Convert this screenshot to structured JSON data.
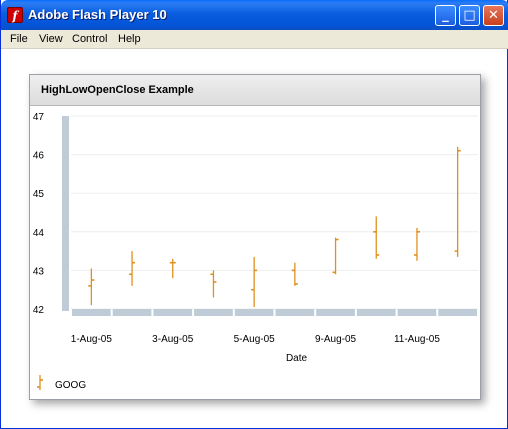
{
  "window": {
    "title": "Adobe Flash Player 10"
  },
  "menu": {
    "items": [
      "File",
      "View",
      "Control",
      "Help"
    ]
  },
  "panel": {
    "title": "HighLowOpenClose Example"
  },
  "colors": {
    "series": "#E0901E",
    "axis_bar": "#BFCBD7",
    "titlebar": "#0A5EE0"
  },
  "chart_data": {
    "type": "hloc",
    "title": "HighLowOpenClose Example",
    "xlabel": "Date",
    "ylabel": "",
    "ylim": [
      42,
      47
    ],
    "yticks": [
      42,
      43,
      44,
      45,
      46,
      47
    ],
    "xtick_labels": [
      "1-Aug-05",
      "3-Aug-05",
      "5-Aug-05",
      "9-Aug-05",
      "11-Aug-05"
    ],
    "legend": {
      "position": "bottom-left",
      "entries": [
        "GOOG"
      ]
    },
    "series": [
      {
        "name": "GOOG",
        "points": [
          {
            "date": "1-Aug-05",
            "open": 42.6,
            "high": 43.05,
            "low": 42.1,
            "close": 42.75
          },
          {
            "date": "2-Aug-05",
            "open": 42.9,
            "high": 43.5,
            "low": 42.6,
            "close": 43.2
          },
          {
            "date": "3-Aug-05",
            "open": 43.2,
            "high": 43.3,
            "low": 42.8,
            "close": 43.2
          },
          {
            "date": "4-Aug-05",
            "open": 42.9,
            "high": 43.0,
            "low": 42.3,
            "close": 42.7
          },
          {
            "date": "5-Aug-05",
            "open": 42.5,
            "high": 43.35,
            "low": 42.05,
            "close": 43.0
          },
          {
            "date": "8-Aug-05",
            "open": 43.0,
            "high": 43.2,
            "low": 42.6,
            "close": 42.65
          },
          {
            "date": "9-Aug-05",
            "open": 42.95,
            "high": 43.85,
            "low": 42.9,
            "close": 43.8
          },
          {
            "date": "10-Aug-05",
            "open": 44.0,
            "high": 44.4,
            "low": 43.3,
            "close": 43.4
          },
          {
            "date": "11-Aug-05",
            "open": 43.4,
            "high": 44.1,
            "low": 43.25,
            "close": 44.0
          },
          {
            "date": "12-Aug-05",
            "open": 43.5,
            "high": 46.2,
            "low": 43.35,
            "close": 46.1
          }
        ]
      }
    ]
  }
}
